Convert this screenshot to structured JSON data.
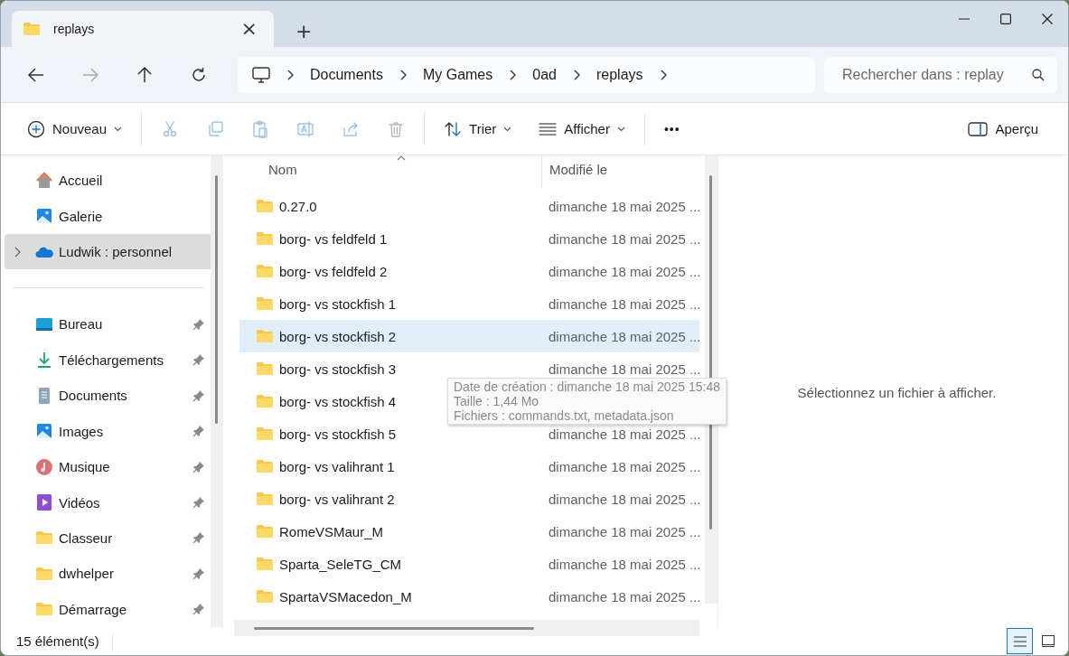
{
  "tab": {
    "title": "replays",
    "close": "×",
    "new": "+"
  },
  "nav": {
    "breadcrumbs": [
      "Documents",
      "My Games",
      "0ad",
      "replays"
    ],
    "search": {
      "placeholder": "Rechercher dans : replay"
    }
  },
  "toolbar": [
    {
      "kind": "new",
      "label": "Nouveau",
      "disabled": false
    },
    {
      "kind": "cut",
      "disabled": true
    },
    {
      "kind": "copy",
      "disabled": true
    },
    {
      "kind": "paste",
      "disabled": true
    },
    {
      "kind": "rename",
      "disabled": true
    },
    {
      "kind": "share",
      "disabled": true
    },
    {
      "kind": "delete",
      "disabled": true
    },
    {
      "kind": "sort",
      "label": "Trier",
      "disabled": false
    },
    {
      "kind": "view",
      "label": "Afficher",
      "disabled": false
    },
    {
      "kind": "more",
      "label": "•••",
      "disabled": false
    }
  ],
  "preview_button": {
    "label": "Aperçu"
  },
  "sidebar": {
    "items": [
      {
        "kind": "home",
        "label": "Accueil",
        "selected": false,
        "pinned": false,
        "expandable": false
      },
      {
        "kind": "gallery",
        "label": "Galerie",
        "selected": false,
        "pinned": false,
        "expandable": false
      },
      {
        "kind": "cloud",
        "label": "Ludwik : personnel",
        "selected": true,
        "pinned": false,
        "expandable": true
      },
      {
        "kind": "divider"
      },
      {
        "kind": "desktop",
        "label": "Bureau",
        "selected": false,
        "pinned": true,
        "expandable": false
      },
      {
        "kind": "download",
        "label": "Téléchargements",
        "selected": false,
        "pinned": true,
        "expandable": false
      },
      {
        "kind": "document",
        "label": "Documents",
        "selected": false,
        "pinned": true,
        "expandable": false
      },
      {
        "kind": "images",
        "label": "Images",
        "selected": false,
        "pinned": true,
        "expandable": false
      },
      {
        "kind": "music",
        "label": "Musique",
        "selected": false,
        "pinned": true,
        "expandable": false
      },
      {
        "kind": "videos",
        "label": "Vidéos",
        "selected": false,
        "pinned": true,
        "expandable": false
      },
      {
        "kind": "folder",
        "label": "Classeur",
        "selected": false,
        "pinned": true,
        "expandable": false
      },
      {
        "kind": "folder",
        "label": "dwhelper",
        "selected": false,
        "pinned": true,
        "expandable": false
      },
      {
        "kind": "folder",
        "label": "Démarrage",
        "selected": false,
        "pinned": true,
        "expandable": false
      }
    ]
  },
  "table": {
    "columns": [
      "Nom",
      "Modifié le"
    ],
    "rows": [
      {
        "name": "0.27.0",
        "modified": "dimanche 18 mai 2025 ...",
        "selected": false
      },
      {
        "name": "borg- vs feldfeld 1",
        "modified": "dimanche 18 mai 2025 ...",
        "selected": false
      },
      {
        "name": "borg- vs feldfeld 2",
        "modified": "dimanche 18 mai 2025 ...",
        "selected": false
      },
      {
        "name": "borg- vs stockfish 1",
        "modified": "dimanche 18 mai 2025 ...",
        "selected": false
      },
      {
        "name": "borg- vs stockfish 2",
        "modified": "dimanche 18 mai 2025 ...",
        "selected": true
      },
      {
        "name": "borg- vs stockfish 3",
        "modified": "dimanche 18 mai 2025 ...",
        "selected": false
      },
      {
        "name": "borg- vs stockfish 4",
        "selected": false
      },
      {
        "name": "borg- vs stockfish 5",
        "modified": "dimanche 18 mai 2025 ...",
        "selected": false
      },
      {
        "name": "borg- vs valihrant 1",
        "modified": "dimanche 18 mai 2025 ...",
        "selected": false
      },
      {
        "name": "borg- vs valihrant 2",
        "modified": "dimanche 18 mai 2025 ...",
        "selected": false
      },
      {
        "name": "RomeVSMaur_M",
        "modified": "dimanche 18 mai 2025 ...",
        "selected": false
      },
      {
        "name": "Sparta_SeleTG_CM",
        "modified": "dimanche 18 mai 2025 ...",
        "selected": false
      },
      {
        "name": "SpartaVSMacedon_M",
        "modified": "dimanche 18 mai 2025 ...",
        "selected": false
      }
    ]
  },
  "tooltip": {
    "lines": [
      "Date de création : dimanche 18 mai 2025 15:48",
      "Taille : 1,44 Mo",
      "Fichiers : commands.txt, metadata.json"
    ]
  },
  "preview_pane": {
    "message": "Sélectionnez un fichier à afficher."
  },
  "status_bar": {
    "count": "15 élément(s)",
    "views": [
      {
        "kind": "details",
        "selected": true
      },
      {
        "kind": "tiles",
        "selected": false
      }
    ]
  }
}
